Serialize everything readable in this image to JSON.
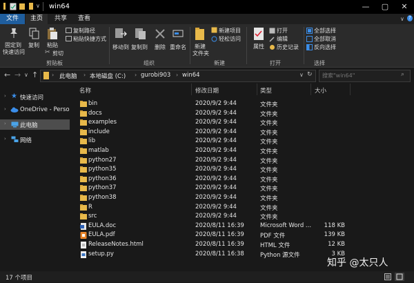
{
  "window": {
    "title": "win64"
  },
  "tabs": [
    "文件",
    "主页",
    "共享",
    "查看"
  ],
  "ribbon": {
    "clipboard": {
      "pin": "固定到",
      "pin2": "快速访问",
      "copy": "复制",
      "paste": "粘贴",
      "copy_path": "复制路径",
      "paste_shortcut": "粘贴快捷方式",
      "cut": "剪切",
      "group": "剪贴板"
    },
    "organize": {
      "move_to": "移动到",
      "copy_to": "复制到",
      "delete": "删除",
      "rename": "重命名",
      "group": "组织"
    },
    "new": {
      "new_folder": "新建",
      "new_folder2": "文件夹",
      "new_item": "新建项目",
      "easy_access": "轻松访问",
      "group": "新建"
    },
    "open": {
      "properties": "属性",
      "open": "打开",
      "edit": "编辑",
      "history": "历史记录",
      "group": "打开"
    },
    "select": {
      "select_all": "全部选择",
      "select_none": "全部取消",
      "invert": "反向选择",
      "group": "选择"
    }
  },
  "address": {
    "crumbs": [
      "此电脑",
      "本地磁盘 (C:)",
      "gurobi903",
      "win64"
    ],
    "search_placeholder": "搜索\"win64\""
  },
  "nav": [
    {
      "label": "快速访问",
      "icon": "star-icon",
      "color": "#3b8eea"
    },
    {
      "label": "OneDrive - Persona",
      "icon": "cloud-icon",
      "color": "#3b8eea"
    },
    {
      "label": "此电脑",
      "icon": "computer-icon",
      "color": "#4aa3e8",
      "selected": true
    },
    {
      "label": "网络",
      "icon": "network-icon",
      "color": "#4aa3e8"
    }
  ],
  "columns": {
    "name": "名称",
    "date": "修改日期",
    "type": "类型",
    "size": "大小"
  },
  "files": [
    {
      "name": "bin",
      "date": "2020/9/2 9:44",
      "type": "文件夹",
      "size": "",
      "icon": "folder-icon"
    },
    {
      "name": "docs",
      "date": "2020/9/2 9:44",
      "type": "文件夹",
      "size": "",
      "icon": "folder-icon"
    },
    {
      "name": "examples",
      "date": "2020/9/2 9:44",
      "type": "文件夹",
      "size": "",
      "icon": "folder-icon"
    },
    {
      "name": "include",
      "date": "2020/9/2 9:44",
      "type": "文件夹",
      "size": "",
      "icon": "folder-icon"
    },
    {
      "name": "lib",
      "date": "2020/9/2 9:44",
      "type": "文件夹",
      "size": "",
      "icon": "folder-icon"
    },
    {
      "name": "matlab",
      "date": "2020/9/2 9:44",
      "type": "文件夹",
      "size": "",
      "icon": "folder-icon"
    },
    {
      "name": "python27",
      "date": "2020/9/2 9:44",
      "type": "文件夹",
      "size": "",
      "icon": "folder-icon"
    },
    {
      "name": "python35",
      "date": "2020/9/2 9:44",
      "type": "文件夹",
      "size": "",
      "icon": "folder-icon"
    },
    {
      "name": "python36",
      "date": "2020/9/2 9:44",
      "type": "文件夹",
      "size": "",
      "icon": "folder-icon"
    },
    {
      "name": "python37",
      "date": "2020/9/2 9:44",
      "type": "文件夹",
      "size": "",
      "icon": "folder-icon"
    },
    {
      "name": "python38",
      "date": "2020/9/2 9:44",
      "type": "文件夹",
      "size": "",
      "icon": "folder-icon"
    },
    {
      "name": "R",
      "date": "2020/9/2 9:44",
      "type": "文件夹",
      "size": "",
      "icon": "folder-icon"
    },
    {
      "name": "src",
      "date": "2020/9/2 9:44",
      "type": "文件夹",
      "size": "",
      "icon": "folder-icon"
    },
    {
      "name": "EULA.doc",
      "date": "2020/8/11 16:39",
      "type": "Microsoft Word ...",
      "size": "118 KB",
      "icon": "word-doc-icon"
    },
    {
      "name": "EULA.pdf",
      "date": "2020/8/11 16:39",
      "type": "PDF 文件",
      "size": "139 KB",
      "icon": "pdf-icon"
    },
    {
      "name": "ReleaseNotes.html",
      "date": "2020/8/11 16:39",
      "type": "HTML 文件",
      "size": "12 KB",
      "icon": "html-file-icon"
    },
    {
      "name": "setup.py",
      "date": "2020/8/11 16:38",
      "type": "Python 源文件",
      "size": "3 KB",
      "icon": "python-file-icon"
    }
  ],
  "status": {
    "count": "17 个项目"
  },
  "watermark": "知乎 @太只人",
  "colors": {
    "folder": "#e8b94a",
    "accent": "#1f5e9e",
    "selected_nav": "#4d4d4d"
  }
}
